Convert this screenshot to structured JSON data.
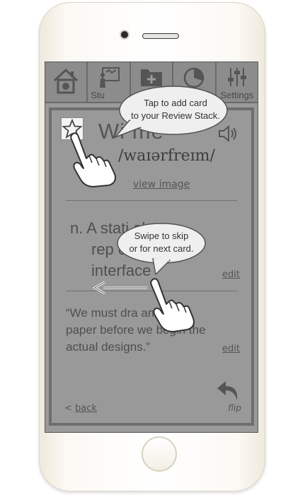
{
  "tabs": [
    {
      "label": "",
      "icon": "home-icon"
    },
    {
      "label": "Stu",
      "icon": "study-board-icon"
    },
    {
      "label": "",
      "icon": "folder-add-icon"
    },
    {
      "label": "",
      "icon": "pie-chart-icon"
    },
    {
      "label": "Settings",
      "icon": "sliders-icon"
    }
  ],
  "card": {
    "word": "Wi        me",
    "pronunciation": "/waɪərfreɪm/",
    "view_image_label": "view image",
    "definition_lines": [
      "n. A stati        al",
      "rep              of an",
      "interface"
    ],
    "example_lines": [
      "“We must dra       ames on",
      "paper before we begin the",
      "actual designs.”"
    ],
    "edit_label": "edit",
    "back_prefix": "<",
    "back_label": "back",
    "flip_label": "flip"
  },
  "tips": {
    "add_card": {
      "line1": "Tap to add card",
      "line2": "to your Review Stack."
    },
    "swipe": {
      "line1": "Swipe to skip",
      "line2": "or for next card."
    }
  },
  "colors": {
    "overlay": "#9a9a9a",
    "tab_bar": "#8c8c8c",
    "bubble": "#efefef"
  }
}
